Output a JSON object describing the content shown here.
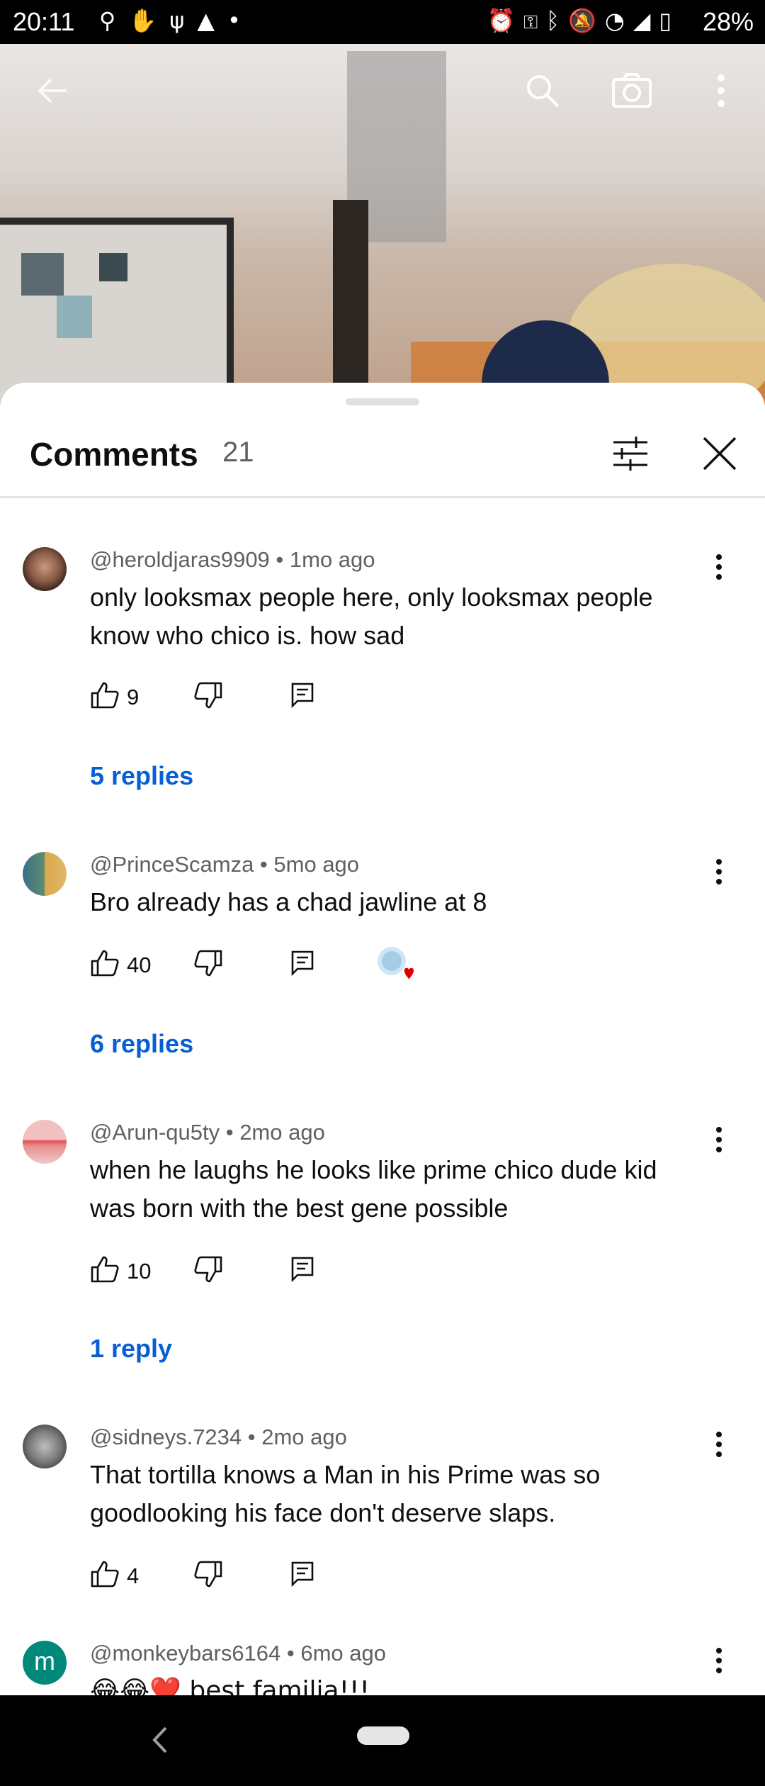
{
  "status_bar": {
    "time": "20:11",
    "battery": "28%",
    "left_icons": [
      "location-icon",
      "hand-icon",
      "usb-icon",
      "warning-icon",
      "dot-icon"
    ],
    "right_icons": [
      "alarm-icon",
      "vpn-key-icon",
      "bluetooth-icon",
      "mute-icon",
      "wifi-icon",
      "signal-icon",
      "battery-icon"
    ]
  },
  "top_bar": {
    "icons": [
      "back-arrow-icon",
      "search-icon",
      "camera-icon",
      "more-vert-icon"
    ]
  },
  "comments_sheet": {
    "title": "Comments",
    "count": "21",
    "filter_icon": "tune-icon",
    "close_icon": "close-icon",
    "comments": [
      {
        "author": "@heroldjaras9909",
        "age": "1mo ago",
        "meta": "@heroldjaras9909 • 1mo ago",
        "text": "only looksmax people here, only looksmax people know who chico is. how sad",
        "likes": "9",
        "replies": "5 replies",
        "creator_heart": false
      },
      {
        "author": "@PrinceScamza",
        "age": "5mo ago",
        "meta": "@PrinceScamza • 5mo ago",
        "text": "Bro already has a chad jawline at 8",
        "likes": "40",
        "replies": "6 replies",
        "creator_heart": true
      },
      {
        "author": "@Arun-qu5ty",
        "age": "2mo ago",
        "meta": "@Arun-qu5ty • 2mo ago",
        "text": "when he laughs he looks like prime chico dude kid was born with the best gene possible",
        "likes": "10",
        "replies": "1 reply",
        "creator_heart": false
      },
      {
        "author": "@sidneys.7234",
        "age": "2mo ago",
        "meta": "@sidneys.7234 • 2mo ago",
        "text": "That tortilla knows a Man in his Prime was so goodlooking his face don't deserve slaps.",
        "likes": "4",
        "replies": "",
        "creator_heart": false
      },
      {
        "author": "@monkeybars6164",
        "age": "6mo ago",
        "meta": "@monkeybars6164 • 6mo ago",
        "text": "😂😂❤️ best familia!!!",
        "avatar_letter": "m",
        "likes": "",
        "replies": "",
        "creator_heart": false
      }
    ]
  },
  "colors": {
    "link_blue": "#065fd4",
    "secondary_text": "#606060",
    "avatar_teal": "#00897b"
  }
}
